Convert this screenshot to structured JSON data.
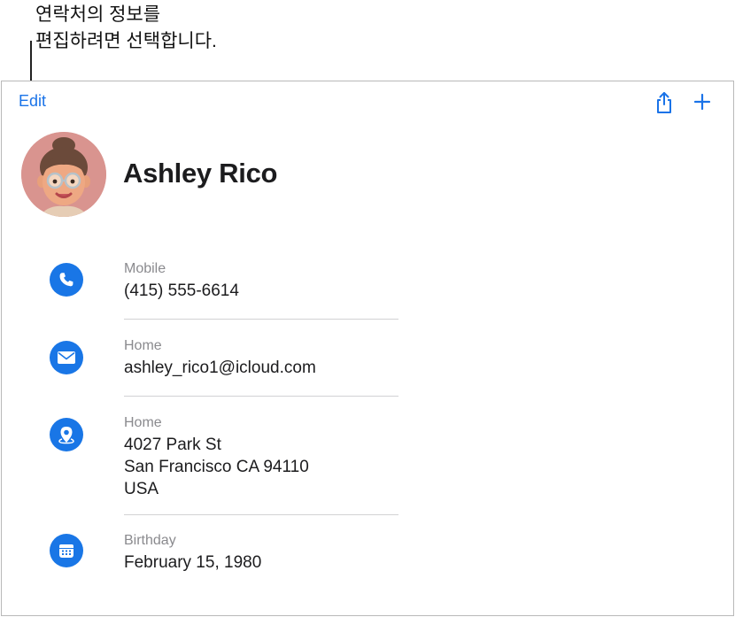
{
  "callout": {
    "line1": "연락처의 정보를",
    "line2": "편집하려면 선택합니다."
  },
  "toolbar": {
    "edit_label": "Edit",
    "share_icon": "share-icon",
    "add_icon": "plus-icon",
    "accent_color": "#1a73e8"
  },
  "contact": {
    "name": "Ashley Rico",
    "avatar": "memoji-avatar",
    "fields": [
      {
        "icon": "phone-icon",
        "label": "Mobile",
        "value": "(415) 555-6614"
      },
      {
        "icon": "mail-icon",
        "label": "Home",
        "value": "ashley_rico1@icloud.com"
      },
      {
        "icon": "location-icon",
        "label": "Home",
        "lines": [
          "4027 Park St",
          "San Francisco CA 94110",
          "USA"
        ]
      },
      {
        "icon": "calendar-icon",
        "label": "Birthday",
        "value": "February 15, 1980"
      }
    ]
  }
}
